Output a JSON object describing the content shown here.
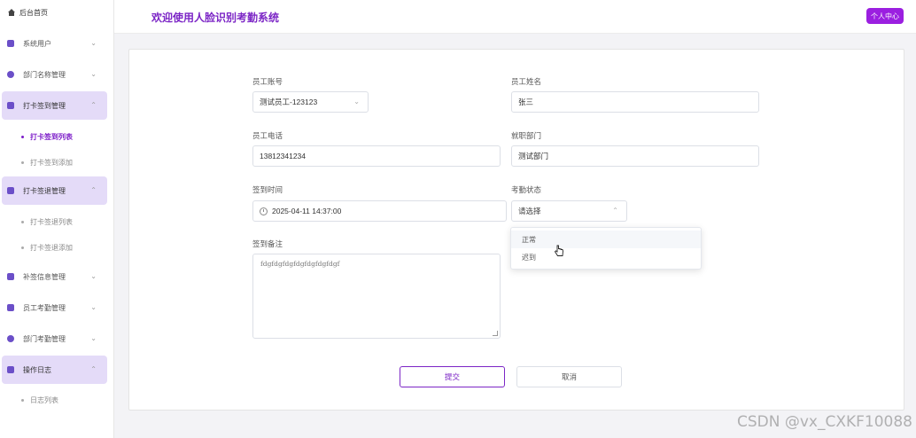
{
  "sidebar": {
    "home": "后台首页",
    "menus": [
      {
        "label": "系统用户"
      },
      {
        "label": "部门名称管理"
      },
      {
        "label": "打卡签到管理"
      },
      {
        "label": "打卡签退管理"
      },
      {
        "label": "补签信息管理"
      },
      {
        "label": "员工考勤管理"
      },
      {
        "label": "部门考勤管理"
      },
      {
        "label": "操作日志"
      }
    ],
    "subs": [
      {
        "label": "打卡签到列表"
      },
      {
        "label": "打卡签到添加"
      },
      {
        "label": "打卡签退列表"
      },
      {
        "label": "打卡签退添加"
      },
      {
        "label": "日志列表"
      }
    ]
  },
  "header": {
    "title": "欢迎使用人脸识别考勤系统",
    "profile_button": "个人中心"
  },
  "form": {
    "account_label": "员工账号",
    "account_value": "测试员工-123123",
    "name_label": "员工姓名",
    "name_value": "张三",
    "phone_label": "员工电话",
    "phone_value": "13812341234",
    "dept_label": "就职部门",
    "dept_value": "测试部门",
    "time_label": "签到时间",
    "time_value": "2025-04-11 14:37:00",
    "status_label": "考勤状态",
    "status_placeholder": "请选择",
    "status_options": [
      "正常",
      "迟到"
    ],
    "remark_label": "签到备注",
    "remark_value": "fdgfdgfdgfdgfdgfdgfdgf"
  },
  "buttons": {
    "submit": "提交",
    "cancel": "取消"
  },
  "watermark": "CSDN @vx_CXKF10088",
  "colors": {
    "accent": "#7c26c6",
    "header_button": "#9b1fe0",
    "active_menu_bg": "#e4dbf8"
  }
}
